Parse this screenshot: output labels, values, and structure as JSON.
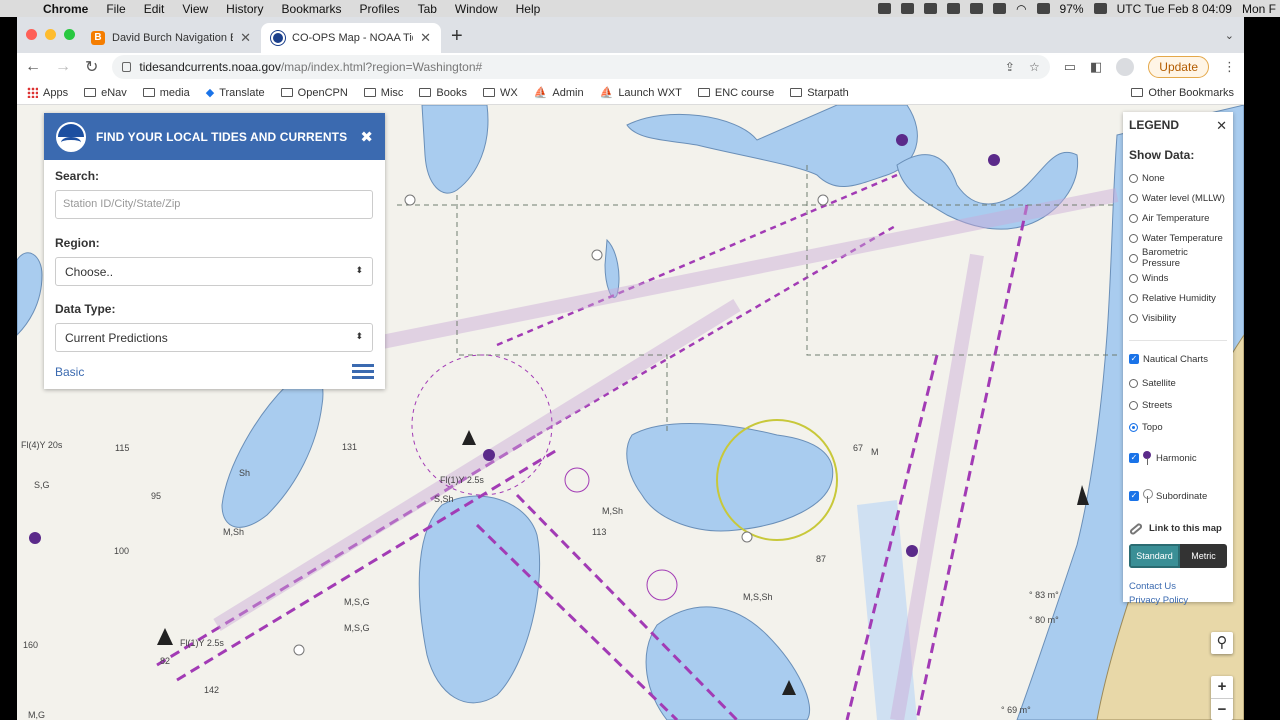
{
  "menubar": {
    "app": "Chrome",
    "items": [
      "File",
      "Edit",
      "View",
      "History",
      "Bookmarks",
      "Profiles",
      "Tab",
      "Window",
      "Help"
    ],
    "battery": "97%",
    "clock": "UTC Tue Feb 8  04:09",
    "clock2": "Mon F"
  },
  "tabs": [
    {
      "title": "David Burch Navigation Blog: N",
      "favicon": "blogger-icon"
    },
    {
      "title": "CO-OPS Map - NOAA Tides & C",
      "favicon": "noaa-icon"
    }
  ],
  "address": {
    "host": "tidesandcurrents.noaa.gov",
    "path": "/map/index.html?region=Washington#"
  },
  "update_label": "Update",
  "bookmarks": [
    "Apps",
    "eNav",
    "media",
    "Translate",
    "OpenCPN",
    "Misc",
    "Books",
    "WX",
    "Admin",
    "Launch WXT",
    "ENC course",
    "Starpath"
  ],
  "other_bookmarks": "Other Bookmarks",
  "panel": {
    "title": "FIND YOUR LOCAL TIDES AND CURRENTS",
    "search_label": "Search:",
    "search_placeholder": "Station ID/City/State/Zip",
    "region_label": "Region:",
    "region_value": "Choose..",
    "type_label": "Data Type:",
    "type_value": "Current Predictions",
    "basic_link": "Basic"
  },
  "legend": {
    "title": "LEGEND",
    "show_data": "Show Data:",
    "data_options": [
      "None",
      "Water level (MLLW)",
      "Air Temperature",
      "Water Temperature",
      "Barometric Pressure",
      "Winds",
      "Relative Humidity",
      "Visibility"
    ],
    "nautical": "Nautical Charts",
    "base_layers": [
      "Satellite",
      "Streets",
      "Topo"
    ],
    "selected_base": "Topo",
    "harmonic": "Harmonic",
    "subordinate": "Subordinate",
    "link": "Link to this map",
    "standard": "Standard",
    "metric": "Metric",
    "contact": "Contact Us",
    "privacy": "Privacy Policy"
  },
  "map_labels": {
    "l1": "Fl(4)Y 20s",
    "l2": "115",
    "l3": "Sh",
    "l4": "S,G",
    "l5": "95",
    "l6": "100",
    "l7": "M,Sh",
    "l8": "Fl(1)Y 2.5s",
    "l9": "Fl(1)Y 2.5s",
    "l10": "131",
    "l11": "S,Sh",
    "l12": "M,Sh",
    "l13": "113",
    "l14": "M,S,Sh",
    "l15": "M,S,G",
    "l16": "M,S,G",
    "l17": "82",
    "l18": "142",
    "l19": "M,G",
    "l20": "160",
    "l21": "° 83 m°",
    "l22": "° 80 m°",
    "l23": "° 69 m°",
    "l24": "67",
    "l25": "87",
    "l26": "M"
  },
  "map_controls": {
    "zoom_in": "+",
    "zoom_out": "−"
  }
}
